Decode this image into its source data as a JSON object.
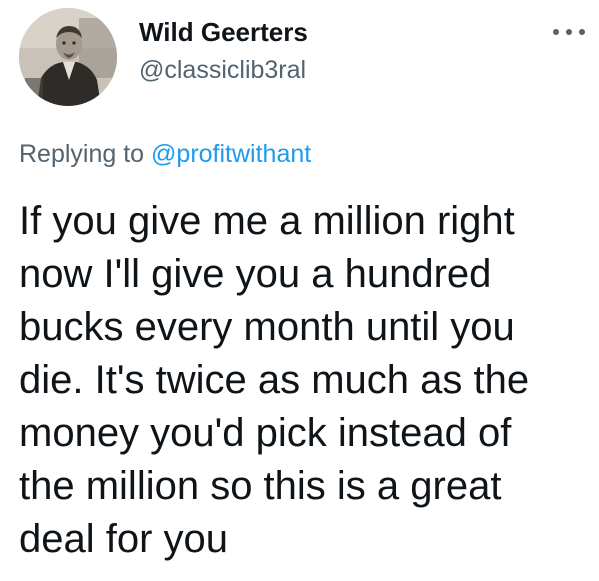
{
  "author": {
    "display_name": "Wild Geerters",
    "handle": "@classiclib3ral",
    "avatar_icon": "vintage-portrait-avatar"
  },
  "menu": {
    "icon": "more-options-icon"
  },
  "reply": {
    "prefix": "Replying to",
    "mention": "@profitwithant"
  },
  "tweet": {
    "lines": [
      "If you give me a million right",
      "now I'll give you a hundred",
      "bucks every month until you",
      "die. It's twice as much as the",
      "money you'd pick instead of",
      "the million so this is a great",
      "deal for you"
    ]
  },
  "colors": {
    "text": "#0f1419",
    "secondary": "#536471",
    "link": "#1d9bf0"
  }
}
